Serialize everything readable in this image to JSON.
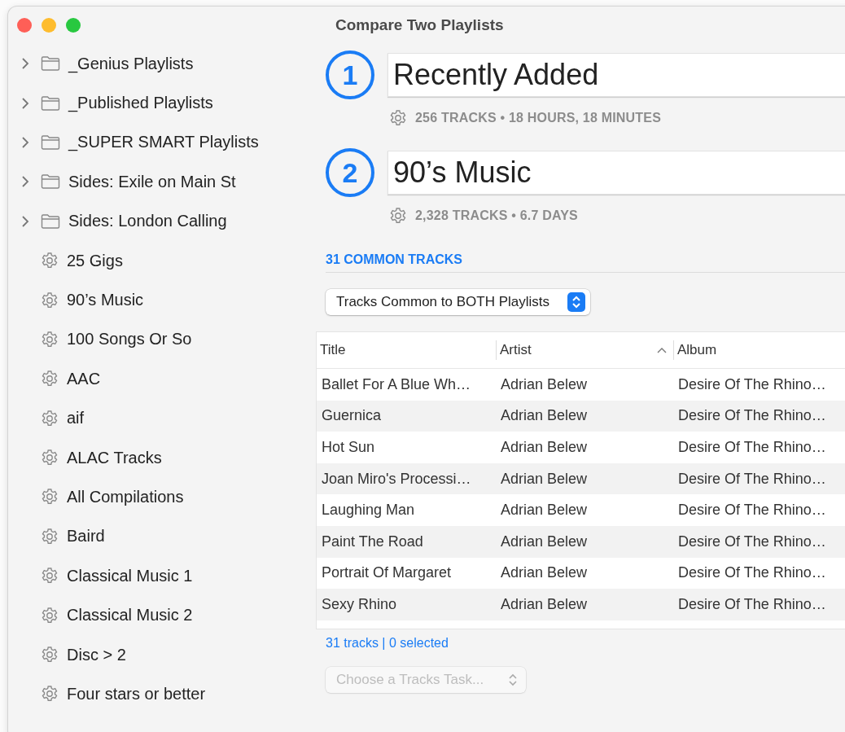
{
  "window": {
    "title": "Compare Two Playlists"
  },
  "sidebar": {
    "items": [
      {
        "kind": "folder",
        "label": "_Genius Playlists",
        "expanded": false
      },
      {
        "kind": "folder",
        "label": "_Published Playlists",
        "expanded": false
      },
      {
        "kind": "folder",
        "label": "_SUPER SMART Playlists",
        "expanded": false
      },
      {
        "kind": "folder",
        "label": "Sides: Exile on Main St",
        "expanded": false
      },
      {
        "kind": "folder",
        "label": "Sides: London Calling",
        "expanded": false
      },
      {
        "kind": "smart",
        "label": "25 Gigs"
      },
      {
        "kind": "smart",
        "label": "90’s Music"
      },
      {
        "kind": "smart",
        "label": "100 Songs Or So"
      },
      {
        "kind": "smart",
        "label": "AAC"
      },
      {
        "kind": "smart",
        "label": "aif"
      },
      {
        "kind": "smart",
        "label": "ALAC Tracks"
      },
      {
        "kind": "smart",
        "label": "All Compilations"
      },
      {
        "kind": "smart",
        "label": "Baird"
      },
      {
        "kind": "smart",
        "label": "Classical Music 1"
      },
      {
        "kind": "smart",
        "label": "Classical Music 2"
      },
      {
        "kind": "smart",
        "label": "Disc > 2"
      },
      {
        "kind": "smart",
        "label": "Four stars or better"
      }
    ]
  },
  "playlists": [
    {
      "number": "1",
      "name": "Recently Added",
      "stats": "256 TRACKS • 18 HOURS, 18 MINUTES"
    },
    {
      "number": "2",
      "name": "90’s Music",
      "stats": "2,328 TRACKS • 6.7 DAYS"
    }
  ],
  "common_heading": "31 COMMON TRACKS",
  "filter_popup": {
    "value": "Tracks Common to BOTH Playlists",
    "disabled": false
  },
  "table": {
    "columns": [
      {
        "label": "Title",
        "sorted": false
      },
      {
        "label": "Artist",
        "sorted": true
      },
      {
        "label": "Album",
        "sorted": false
      }
    ],
    "rows": [
      [
        "Ballet For A Blue Wh…",
        "Adrian Belew",
        "Desire Of The Rhino…"
      ],
      [
        "Guernica",
        "Adrian Belew",
        "Desire Of The Rhino…"
      ],
      [
        "Hot Sun",
        "Adrian Belew",
        "Desire Of The Rhino…"
      ],
      [
        "Joan Miro's Processi…",
        "Adrian Belew",
        "Desire Of The Rhino…"
      ],
      [
        "Laughing Man",
        "Adrian Belew",
        "Desire Of The Rhino…"
      ],
      [
        "Paint The Road",
        "Adrian Belew",
        "Desire Of The Rhino…"
      ],
      [
        "Portrait Of Margaret",
        "Adrian Belew",
        "Desire Of The Rhino…"
      ],
      [
        "Sexy Rhino",
        "Adrian Belew",
        "Desire Of The Rhino…"
      ]
    ]
  },
  "status": "31 tracks | 0 selected",
  "task_popup": {
    "placeholder": "Choose a Tracks Task...",
    "disabled": true
  }
}
